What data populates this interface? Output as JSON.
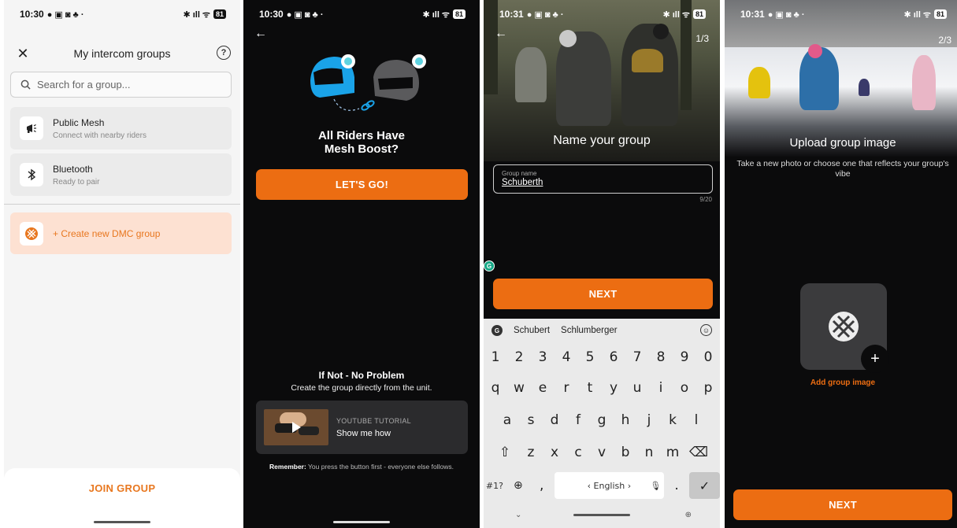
{
  "screen1": {
    "status": {
      "time": "10:30",
      "battery": "81"
    },
    "title": "My intercom groups",
    "search_placeholder": "Search for a group...",
    "items": [
      {
        "title": "Public Mesh",
        "subtitle": "Connect with nearby riders",
        "icon": "megaphone-icon"
      },
      {
        "title": "Bluetooth",
        "subtitle": "Ready to pair",
        "icon": "bluetooth-icon"
      }
    ],
    "create_label": "+ Create new DMC group",
    "join_label": "JOIN GROUP"
  },
  "screen2": {
    "status": {
      "time": "10:30",
      "battery": "81"
    },
    "title_line1": "All Riders Have",
    "title_line2": "Mesh Boost?",
    "cta_label": "LET'S GO!",
    "if_not_title": "If Not - No Problem",
    "if_not_sub": "Create the group directly from the unit.",
    "tutorial": {
      "kicker": "YOUTUBE TUTORIAL",
      "label": "Show me how"
    },
    "remember_bold": "Remember:",
    "remember_text": "You press the button first - everyone else follows."
  },
  "screen3": {
    "status": {
      "time": "10:31",
      "battery": "81"
    },
    "step": "1/3",
    "title": "Name your group",
    "field_label": "Group name",
    "field_value": "Schuberth",
    "char_count": "9/20",
    "next_label": "NEXT",
    "suggestions": [
      "Schubert",
      "Schlumberger"
    ],
    "keyboard": {
      "row_numbers": [
        "1",
        "2",
        "3",
        "4",
        "5",
        "6",
        "7",
        "8",
        "9",
        "0"
      ],
      "row1": [
        "q",
        "w",
        "e",
        "r",
        "t",
        "y",
        "u",
        "i",
        "o",
        "p"
      ],
      "row2": [
        "a",
        "s",
        "d",
        "f",
        "g",
        "h",
        "j",
        "k",
        "l"
      ],
      "row3": [
        "z",
        "x",
        "c",
        "v",
        "b",
        "n",
        "m"
      ],
      "symbols_key": "#1?",
      "comma": ",",
      "space_label": "‹ English ›",
      "period": "."
    }
  },
  "screen4": {
    "status": {
      "time": "10:31",
      "battery": "81"
    },
    "step": "2/3",
    "title": "Upload group image",
    "subtitle": "Take a new photo or choose one that reflects your group's vibe",
    "add_label": "Add group image",
    "next_label": "NEXT"
  },
  "colors": {
    "accent": "#ec6d12",
    "dark_bg": "#0b0b0c",
    "create_bg": "#fde1d2"
  }
}
